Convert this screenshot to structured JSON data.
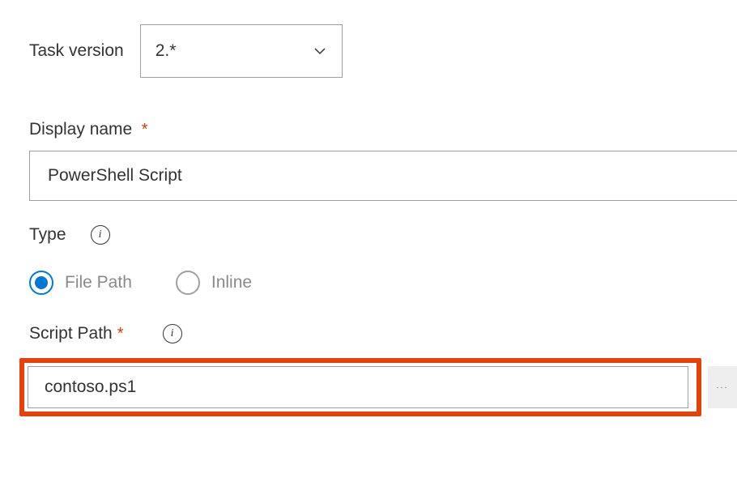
{
  "taskVersion": {
    "label": "Task version",
    "value": "2.*"
  },
  "displayName": {
    "label": "Display name",
    "value": "PowerShell Script"
  },
  "type": {
    "label": "Type",
    "options": {
      "filePath": "File Path",
      "inline": "Inline"
    },
    "selected": "filePath"
  },
  "scriptPath": {
    "label": "Script Path",
    "value": "contoso.ps1"
  },
  "browseButton": "···"
}
